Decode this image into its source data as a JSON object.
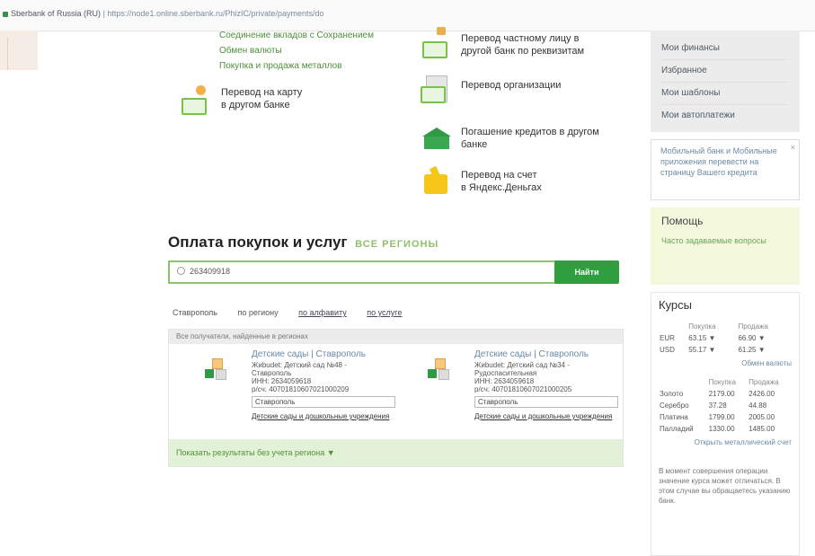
{
  "browser": {
    "site": "Sberbank of Russia (RU)",
    "url": "https://node1.online.sberbank.ru/PhizIC/private/payments/do"
  },
  "top_links": [
    "Соединение вкладов с Сохранением",
    "Обмен валюты",
    "Покупка и продажа металлов"
  ],
  "transfers": {
    "to_card": "Перевод на карту\nв другом банке",
    "private_person": "Перевод частному лицу в\nдругой банк по реквизитам",
    "organization": "Перевод организации",
    "loan_repayment": "Погашение кредитов в другом\nбанке",
    "yandex": "Перевод на счет\nв Яндекс.Деньгах"
  },
  "sidebar_menu": [
    "Мои финансы",
    "Избранное",
    "Мои шаблоны",
    "Мои автоплатежи"
  ],
  "promo": {
    "text": "Мобильный банк и Мобильные приложения перевести на страницу Вашего кредита",
    "close": "×"
  },
  "help": {
    "title": "Помощь",
    "link": "Часто задаваемые вопросы"
  },
  "rates": {
    "title": "Курсы",
    "currency_header": [
      "",
      "Покупка",
      "Продажа"
    ],
    "currency_rows": [
      [
        "EUR",
        "63.15 ▼",
        "66.90 ▼"
      ],
      [
        "USD",
        "55.17 ▼",
        "61.25 ▼"
      ]
    ],
    "currency_link": "Обмен валюты",
    "metal_header": [
      "",
      "Покупка",
      "Продажа"
    ],
    "metal_rows": [
      [
        "Золото",
        "2179.00",
        "2426.00"
      ],
      [
        "Серебро",
        "37.28",
        "44.88"
      ],
      [
        "Платина",
        "1799.00",
        "2005.00"
      ],
      [
        "Палладий",
        "1330.00",
        "1485.00"
      ]
    ],
    "metal_link": "Открыть металлический счет",
    "note": "В момент совершения операции значение курса может отличаться. В этом случае вы обращаетесь указанию банк."
  },
  "payments": {
    "heading": "Оплата покупок и услуг",
    "regions": "ВСЕ РЕГИОНЫ",
    "search_value": "263409918",
    "search_button": "Найти",
    "tabs": [
      "Ставрополь",
      "по региону",
      "по алфавиту",
      "по услуге"
    ],
    "results_header": "Все получатели, найденные в регионах",
    "results": [
      {
        "title": "Детские сады | Ставрополь",
        "desc": [
          "Жиbudet: Детский сад №48 -",
          "Ставрополь",
          "ИНН: 2634059618",
          "р/сч: 40701810607021000209"
        ],
        "select": "Ставрополь",
        "category": "Детские сады и дошкольные учреждения"
      },
      {
        "title": "Детские сады | Ставрополь",
        "desc": [
          "Жиbudet: Детский сад №34 -",
          "Рудоспасительная",
          "ИНН: 2634059618",
          "р/сч: 40701810607021000205"
        ],
        "select": "Ставрополь",
        "category": "Детские сады и дошкольные учреждения"
      }
    ],
    "more": "Показать результаты без учета региона ▼"
  }
}
